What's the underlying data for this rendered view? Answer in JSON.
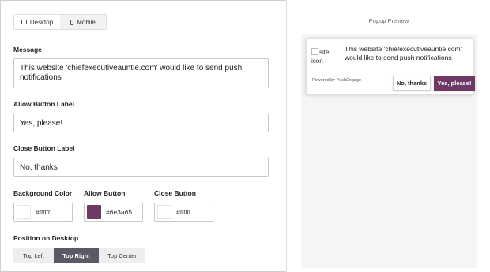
{
  "device_toggle": {
    "desktop_label": "Desktop",
    "mobile_label": "Mobile",
    "selected": "Desktop"
  },
  "fields": {
    "message_label": "Message",
    "message_value": "This website 'chiefexecutiveauntie.com' would like to send push notifications",
    "allow_label": "Allow Button Label",
    "allow_value": "Yes, please!",
    "close_label": "Close Button Label",
    "close_value": "No, thanks"
  },
  "colors": {
    "background_label": "Background Color",
    "background_value": "#ffffff",
    "allow_label": "Allow Button",
    "allow_value": "#6e3a65",
    "close_label": "Close Button",
    "close_value": "#ffffff"
  },
  "position": {
    "label": "Position on Desktop",
    "options": [
      "Top Left",
      "Top Right",
      "Top Center"
    ],
    "selected": "Top Right"
  },
  "preview": {
    "title": "Popup Preview",
    "site_icon_alt": "site icon",
    "message": "This website 'chiefexecutiveauntie.com' would like to send push notifications",
    "powered_by": "Powered by PushEngage",
    "close_button": "No, thanks",
    "allow_button": "Yes, please!"
  }
}
